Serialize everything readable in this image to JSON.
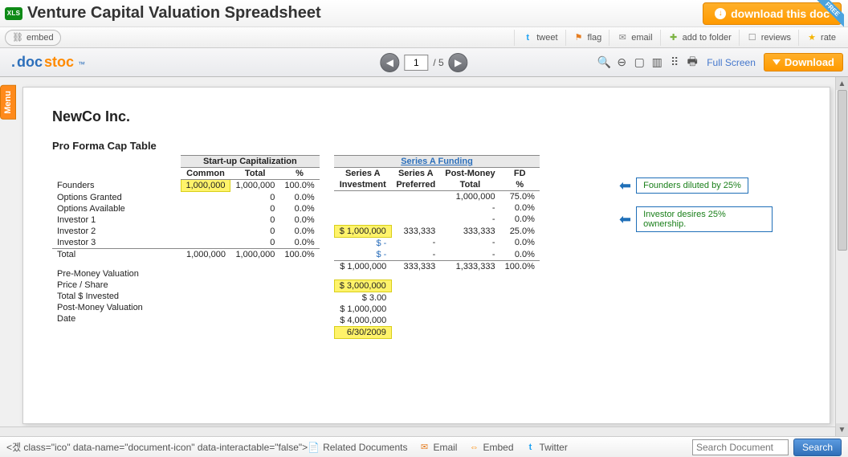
{
  "header": {
    "badge": "XLS",
    "title": "Venture Capital Valuation Spreadsheet",
    "download_label": "download this doc",
    "free_label": "FREE"
  },
  "actionbar": {
    "embed": "embed",
    "tweet": "tweet",
    "flag": "flag",
    "email": "email",
    "add_folder": "add to folder",
    "reviews": "reviews",
    "rate": "rate"
  },
  "viewer": {
    "logo_dot": ".",
    "logo_doc": "doc",
    "logo_stoc": "stoc",
    "logo_tm": "™",
    "page_current": "1",
    "page_total": "/ 5",
    "fullscreen": "Full Screen",
    "download": "Download",
    "menu_tab": "Menu"
  },
  "document": {
    "company": "NewCo Inc.",
    "section": "Pro Forma Cap Table",
    "group1_header": "Start-up Capitalization",
    "group2_header": "Series A Funding",
    "cols": {
      "common": "Common",
      "total": "Total",
      "pct": "%",
      "sa_inv_1": "Series A",
      "sa_inv_2": "Investment",
      "sa_pref_1": "Series A",
      "sa_pref_2": "Preferred",
      "pm_total_1": "Post-Money",
      "pm_total_2": "Total",
      "fd_1": "FD",
      "fd_2": "%"
    },
    "rows": [
      {
        "label": "Founders",
        "common": "1,000,000",
        "total": "1,000,000",
        "pct": "100.0%",
        "sainv": "",
        "sapref": "",
        "pmtotal": "1,000,000",
        "fd": "75.0%",
        "hl_common": true
      },
      {
        "label": "Options Granted",
        "common": "",
        "total": "0",
        "pct": "0.0%",
        "sainv": "",
        "sapref": "",
        "pmtotal": "-",
        "fd": "0.0%"
      },
      {
        "label": "Options Available",
        "common": "",
        "total": "0",
        "pct": "0.0%",
        "sainv": "",
        "sapref": "",
        "pmtotal": "-",
        "fd": "0.0%"
      },
      {
        "label": "Investor 1",
        "common": "",
        "total": "0",
        "pct": "0.0%",
        "sainv": "$ 1,000,000",
        "sapref": "333,333",
        "pmtotal": "333,333",
        "fd": "25.0%",
        "hl_sainv": true
      },
      {
        "label": "Investor 2",
        "common": "",
        "total": "0",
        "pct": "0.0%",
        "sainv": "$        -",
        "sapref": "-",
        "pmtotal": "-",
        "fd": "0.0%",
        "blue_sainv": true
      },
      {
        "label": "Investor 3",
        "common": "",
        "total": "0",
        "pct": "0.0%",
        "sainv": "$        -",
        "sapref": "-",
        "pmtotal": "-",
        "fd": "0.0%",
        "blue_sainv": true
      }
    ],
    "total_row": {
      "label": "Total",
      "common": "1,000,000",
      "total": "1,000,000",
      "pct": "100.0%",
      "sainv": "$ 1,000,000",
      "sapref": "333,333",
      "pmtotal": "1,333,333",
      "fd": "100.0%"
    },
    "summary": [
      {
        "label": "Pre-Money Valuation",
        "value": "$ 3,000,000",
        "hl": true
      },
      {
        "label": "Price / Share",
        "value": "$        3.00"
      },
      {
        "label": "Total $ Invested",
        "value": "$ 1,000,000"
      },
      {
        "label": "Post-Money Valuation",
        "value": "$ 4,000,000"
      },
      {
        "label": "Date",
        "value": "6/30/2009",
        "hl": true
      }
    ],
    "callouts": [
      "Founders diluted by 25%",
      "Investor desires 25% ownership."
    ]
  },
  "bottom": {
    "related": "Related Documents",
    "email": "Email",
    "embed": "Embed",
    "twitter": "Twitter",
    "search_placeholder": "Search Document",
    "search_btn": "Search"
  }
}
